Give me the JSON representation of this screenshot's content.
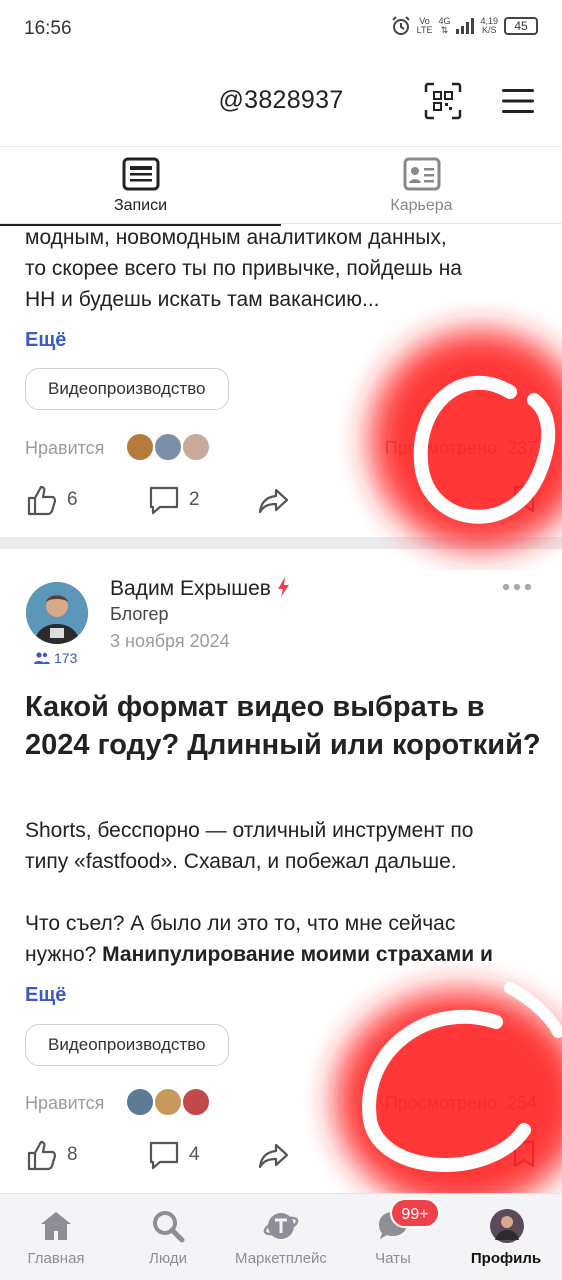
{
  "status_bar": {
    "time": "16:56",
    "network_top": "Vo",
    "network_bottom": "LTE",
    "signal": "4G",
    "speed_top": "4,19",
    "speed_bottom": "K/S",
    "battery": "45"
  },
  "header": {
    "handle": "@3828937"
  },
  "tabs": [
    {
      "label": "Записи",
      "active": true
    },
    {
      "label": "Карьера",
      "active": false
    }
  ],
  "post1": {
    "lines": [
      "модным, новомодным аналитиком данных,",
      "то скорее всего ты по привычке, пойдешь на",
      "НН и будешь искать там вакансию..."
    ],
    "more": "Ещё",
    "tag": "Видеопроизводство",
    "likes_label": "Нравится",
    "views": "Просмотрено: 237",
    "likes_count": "6",
    "comments_count": "2"
  },
  "post2": {
    "author_name": "Вадим Ехрышев",
    "author_role": "Блогер",
    "date": "3 ноября 2024",
    "followers": "173",
    "title": "Какой формат видео выбрать в 2024 году? Длинный или короткий?",
    "lines": [
      "Shorts, бесспорно — отличный инструмент по",
      "типу «fastfood». Схавал, и побежал дальше."
    ],
    "lines2": [
      "Что съел? А было ли это то, что мне сейчас"
    ],
    "line_last_plain": "нужно? ",
    "line_last_bold": "Манипулирование моими страхами и",
    "more": "Ещё",
    "tag": "Видеопроизводство",
    "likes_label": "Нравится",
    "views": "Просмотрено: 254",
    "likes_count": "8",
    "comments_count": "4"
  },
  "bottom_nav": [
    {
      "label": "Главная",
      "icon": "home-icon"
    },
    {
      "label": "Люди",
      "icon": "search-icon"
    },
    {
      "label": "Маркетплейс",
      "icon": "marketplace-icon"
    },
    {
      "label": "Чаты",
      "icon": "chat-icon"
    },
    {
      "label": "Профиль",
      "icon": "avatar",
      "active": true
    }
  ],
  "chats_badge": "99+",
  "colors": {
    "link": "#3a5bc7",
    "badge": "#f0404a",
    "scribble": "#ff1a1a"
  }
}
